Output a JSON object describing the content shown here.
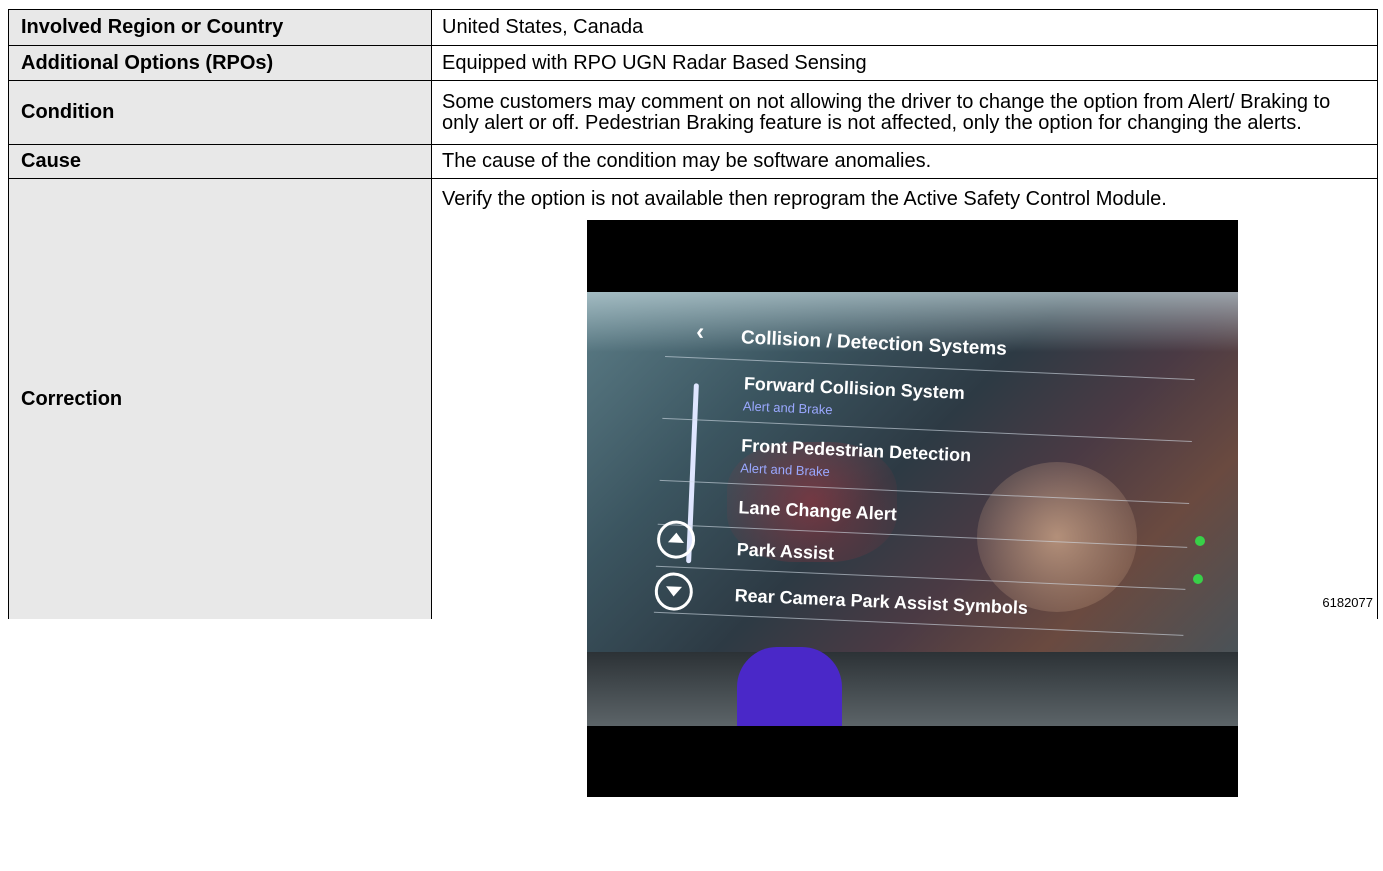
{
  "table": {
    "rows": [
      {
        "label": "Involved Region or Country",
        "value": "United States, Canada"
      },
      {
        "label": "Additional Options (RPOs)",
        "value": "Equipped with RPO UGN Radar Based Sensing"
      },
      {
        "label": "Condition",
        "value": "Some customers may comment on not allowing the driver to change the option from Alert/ Braking to only alert or off. Pedestrian Braking feature is not affected, only the option for changing the alerts."
      },
      {
        "label": "Cause",
        "value": "The cause of the condition may be software anomalies."
      },
      {
        "label": "Correction",
        "value": "Verify the option is not available then reprogram the Active Safety Control Module."
      }
    ]
  },
  "photo": {
    "screen_title": "Collision / Detection Systems",
    "items": [
      {
        "label": "Forward Collision System",
        "sub": "Alert and Brake"
      },
      {
        "label": "Front Pedestrian Detection",
        "sub": "Alert and Brake"
      },
      {
        "label": "Lane Change Alert"
      },
      {
        "label": "Park Assist"
      },
      {
        "label": "Rear Camera Park Assist Symbols"
      }
    ],
    "figure_id": "6182077"
  },
  "icons": {
    "back": "chevron-left-icon",
    "up": "scroll-up-icon",
    "down": "scroll-down-icon"
  }
}
